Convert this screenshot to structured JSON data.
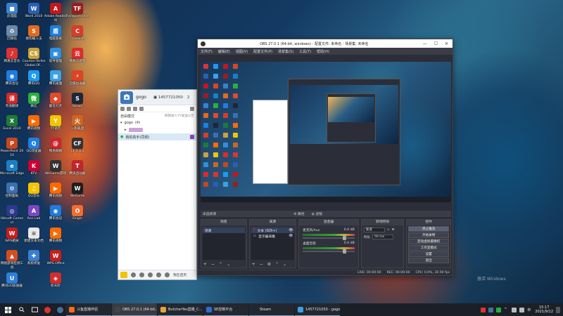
{
  "desktop_icons": [
    {
      "label": "此电脑",
      "color": "#3b7fd0",
      "glyph": "■"
    },
    {
      "label": "回收站",
      "color": "#6c8aa8",
      "glyph": "♻"
    },
    {
      "label": "网易云音乐",
      "color": "#d33",
      "glyph": "♪"
    },
    {
      "label": "腾讯会议",
      "color": "#1e7be0",
      "glyph": "◉"
    },
    {
      "label": "有道翻译",
      "color": "#d02828",
      "glyph": "译"
    },
    {
      "label": "Excel 2010",
      "color": "#1f7a3a",
      "glyph": "X"
    },
    {
      "label": "PowerPoint 2010",
      "color": "#c8461f",
      "glyph": "P"
    },
    {
      "label": "Microsoft Edge",
      "color": "#1b7fc4",
      "glyph": "e"
    },
    {
      "label": "控制面板",
      "color": "#3a6fb0",
      "glyph": "⚙"
    },
    {
      "label": "Ubisoft Connect",
      "color": "#2b3a8c",
      "glyph": "◎"
    },
    {
      "label": "WPS相关",
      "color": "#c81e1e",
      "glyph": "W"
    },
    {
      "label": "网络游戏检测工具",
      "color": "#d64d1f",
      "glyph": "▲"
    },
    {
      "label": "腾讯UU加速器",
      "color": "#2d7fd8",
      "glyph": "U"
    }
  ],
  "desktop_icons_col2": [
    {
      "label": "Word 2010",
      "color": "#2b5fb0",
      "glyph": "W"
    },
    {
      "label": "搜狗输入法",
      "color": "#e46a1c",
      "glyph": "S"
    },
    {
      "label": "Counter-Strike Global Of...",
      "color": "#caa23a",
      "glyph": "CS"
    },
    {
      "label": "腾讯QQ",
      "color": "#1d9bf0",
      "glyph": "Q"
    },
    {
      "label": "微信",
      "color": "#2aae3c",
      "glyph": "微"
    },
    {
      "label": "腾讯视频",
      "color": "#ff6a00",
      "glyph": "▶"
    },
    {
      "label": "QQ浏览器",
      "color": "#1f80e0",
      "glyph": "Q"
    },
    {
      "label": "KTV",
      "color": "#c03",
      "glyph": "K"
    },
    {
      "label": "QQ音乐",
      "color": "#f5c400",
      "glyph": "♫"
    },
    {
      "label": "Ann Lab",
      "color": "#7a48c0",
      "glyph": "A"
    },
    {
      "label": "新建文本文档",
      "color": "#e9e9e9",
      "glyph": "≡"
    },
    {
      "label": "系统修复",
      "color": "#3a7ed0",
      "glyph": "✚"
    }
  ],
  "desktop_icons_col3": [
    {
      "label": "Adobe Reader XI",
      "color": "#c4161c",
      "glyph": "A"
    },
    {
      "label": "电脑管家",
      "color": "#1d7ee0",
      "glyph": "盾"
    },
    {
      "label": "软件管理",
      "color": "#2d8fe0",
      "glyph": "▣"
    },
    {
      "label": "腾讯桌面",
      "color": "#3aa1e8",
      "glyph": "▦"
    },
    {
      "label": "最近打开",
      "color": "#e24a2a",
      "glyph": "◆"
    },
    {
      "label": "YY语音",
      "color": "#f2c500",
      "glyph": "Y"
    },
    {
      "label": "网易邮箱",
      "color": "#c8282d",
      "glyph": "@"
    },
    {
      "label": "WeGame游戏",
      "color": "#333",
      "glyph": "W"
    },
    {
      "label": "腾讯视频",
      "color": "#ff6a00",
      "glyph": "▶"
    },
    {
      "label": "腾讯会议",
      "color": "#1e7be0",
      "glyph": "◉"
    },
    {
      "label": "腾讯视频",
      "color": "#ff6a00",
      "glyph": "▶"
    },
    {
      "label": "WPS Office",
      "color": "#c81e1e",
      "glyph": "W"
    },
    {
      "label": "听天听",
      "color": "#d02d2d",
      "glyph": "◈"
    }
  ],
  "desktop_icons_col4": [
    {
      "label": "Transport Fever",
      "color": "#9a1e1e",
      "glyph": "TF"
    },
    {
      "label": "CCleaner",
      "color": "#d83c2a",
      "glyph": "C"
    },
    {
      "label": "网易云游戏",
      "color": "#e02a2a",
      "glyph": "云"
    },
    {
      "label": "迅雷加速器",
      "color": "#d42",
      "glyph": "⚡"
    },
    {
      "label": "Steam",
      "color": "#1b2838",
      "glyph": "S"
    },
    {
      "label": "火影联盟",
      "color": "#c62",
      "glyph": "火"
    },
    {
      "label": "CF 5.0.3",
      "color": "#333",
      "glyph": "CF"
    },
    {
      "label": "腾讯启动器",
      "color": "#c0262b",
      "glyph": "T"
    },
    {
      "label": "WeGame",
      "color": "#1e1e1e",
      "glyph": "W"
    },
    {
      "label": "Origin",
      "color": "#f56c2d",
      "glyph": "O"
    }
  ],
  "chat": {
    "name": "gogo",
    "id": "1457721050",
    "count": "2",
    "mode_label": "自由模式",
    "mode_right": "请我进入YY发送公告",
    "group_label": "gogo",
    "member_count": "(4)",
    "member_line": "我的高手(同频)",
    "bottom_right": "我在首页"
  },
  "obs": {
    "title": "OBS 27.0.1 (64-bit, windows) - 配置文件: 未命名 - 场景集: 未命名",
    "menu": [
      "文件(F)",
      "编辑(E)",
      "视图(V)",
      "配置文件(P)",
      "场景集(S)",
      "工具(T)",
      "帮助(H)"
    ],
    "no_source": "未选择源",
    "properties": "属性",
    "filters": "滤镜",
    "docks": {
      "scenes": "场景",
      "sources": "来源",
      "mixer": "混音器",
      "transitions": "转场特效",
      "controls": "控件"
    },
    "scene_items": [
      "场景"
    ],
    "source_items": [
      "文本 (GDI+)",
      "显示器采集"
    ],
    "mixer_items": [
      {
        "name": "麦克风/Aux",
        "db": "0.0 dB"
      },
      {
        "name": "桌面音频",
        "db": "0.0 dB"
      }
    ],
    "transition_value": "渐变",
    "duration_label": "时长",
    "duration_value": "50 ms",
    "control_buttons": [
      "停止推流",
      "开始录制",
      "启动虚拟摄像机",
      "工作室模式",
      "设置",
      "退出"
    ],
    "status": {
      "live": "LIVE: 00:00:00",
      "rec": "REC: 00:00:00",
      "cpu": "CPU: 0.0%, 30.00 fps"
    }
  },
  "taskbar": {
    "apps": [
      {
        "label": "斗鱼直播伴侣",
        "color": "#ff6a1a",
        "active": false
      },
      {
        "label": "OBS 27.0.1 (64-bit...",
        "color": "#444",
        "active": true
      },
      {
        "label": "ButcherYes直播_C...",
        "color": "#e8a23a",
        "active": false
      },
      {
        "label": "SE控制平台",
        "color": "#2d6fd0",
        "active": false
      },
      {
        "label": "Steam",
        "color": "#1b2838",
        "active": false
      },
      {
        "label": "1457721050 - gogo",
        "color": "#3aa1e8",
        "active": false
      }
    ],
    "time": "15:17",
    "date": "2021/9/12"
  },
  "watermark": "激活 Windows"
}
